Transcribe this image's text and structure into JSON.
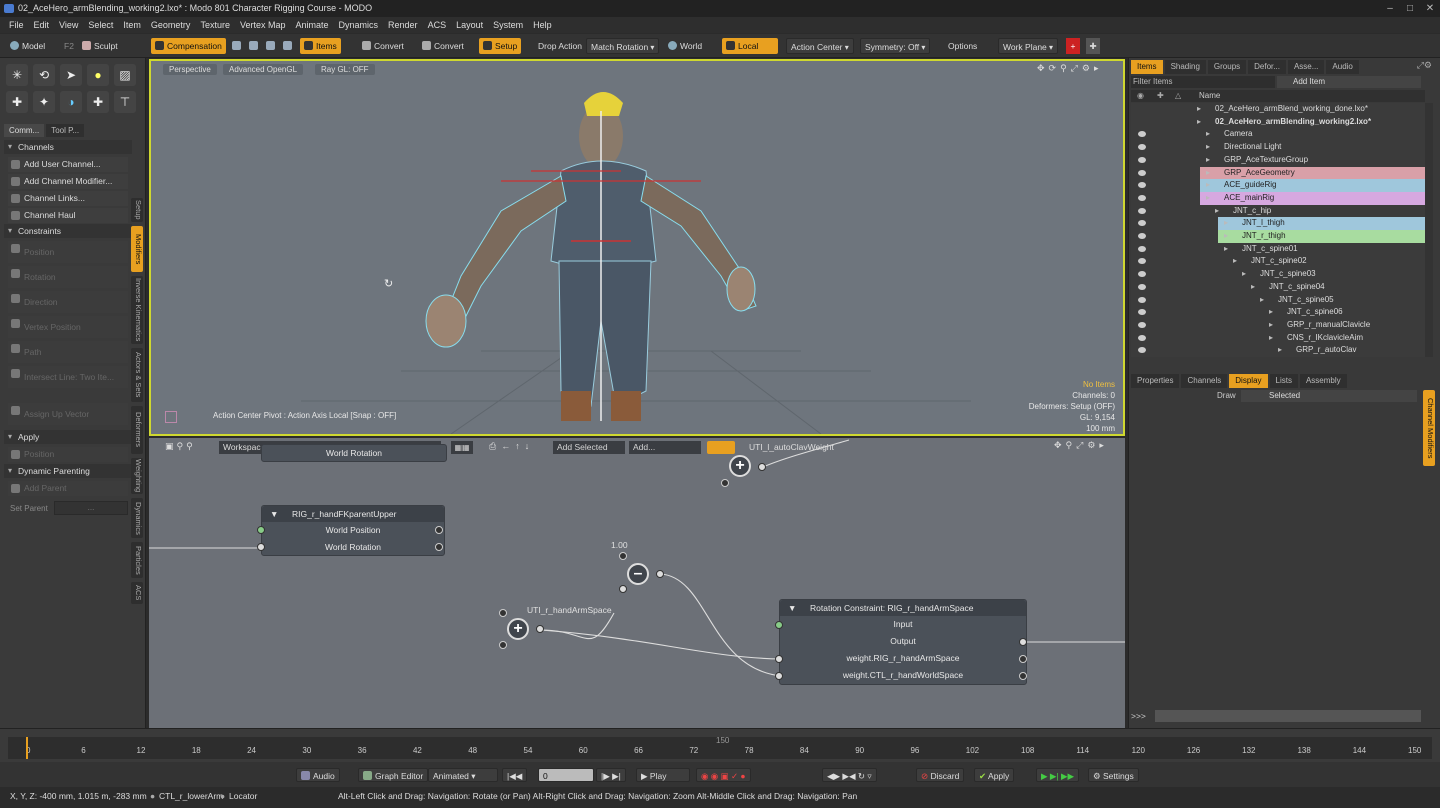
{
  "window": {
    "title": "02_AceHero_armBlending_working2.lxo* : Modo 801 Character Rigging Course - MODO"
  },
  "menu": [
    "File",
    "Edit",
    "View",
    "Select",
    "Item",
    "Geometry",
    "Texture",
    "Vertex Map",
    "Animate",
    "Dynamics",
    "Render",
    "ACS",
    "Layout",
    "System",
    "Help"
  ],
  "toolbar": {
    "model": "Model",
    "f2": "F2",
    "sculpt": "Sculpt",
    "compensation": "Compensation",
    "items": "Items",
    "convert1": "Convert",
    "convert2": "Convert",
    "setup": "Setup",
    "drop_action": "Drop Action",
    "match_rotation": "Match Rotation",
    "world": "World",
    "local": "Local",
    "action_center": "Action Center",
    "symmetry": "Symmetry: Off",
    "options": "Options",
    "work_plane": "Work Plane"
  },
  "left_panel": {
    "tabs": [
      "Comm...",
      "Tool P..."
    ],
    "vertical_tabs": [
      "Setup",
      "Modifiers",
      "Inverse Kinematics",
      "Actors & Sets",
      "Deformers",
      "Weighting",
      "Dynamics",
      "Particles",
      "ACS"
    ],
    "channels_header": "Channels",
    "channel_buttons": [
      "Add User Channel...",
      "Add Channel Modifier...",
      "Channel Links...",
      "Channel Haul"
    ],
    "constraints_header": "Constraints",
    "constraint_buttons": [
      "Position",
      "Rotation",
      "Direction",
      "Vertex Position",
      "Path",
      "Intersect Line: Two Ite..."
    ],
    "assign_up_vector": "Assign Up Vector",
    "apply_header": "Apply",
    "apply_position": "Position",
    "dynamic_parenting_header": "Dynamic Parenting",
    "add_parent": "Add Parent",
    "set_parent": "Set Parent",
    "set_parent_value": "..."
  },
  "viewport": {
    "view_label": "Perspective",
    "shading": "Advanced OpenGL",
    "raygl": "Ray GL: OFF",
    "status_line": "Action Center Pivot : Action Axis Local  [Snap : OFF]",
    "info": {
      "no_items": "No Items",
      "channels": "Channels: 0",
      "deformers": "Deformers: Setup (OFF)",
      "gl": "GL: 9,154",
      "scale": "100 mm"
    }
  },
  "node_editor": {
    "workspace_label": "Workspace: Workspace",
    "add_selected": "Add Selected",
    "add": "Add...",
    "nodes": {
      "world_rotation": "World Rotation",
      "hand_fk_parent": {
        "title": "RIG_r_handFKparentUpper",
        "rows": [
          "World Position",
          "World Rotation"
        ]
      },
      "rotation_constraint": {
        "title": "Rotation Constraint: RIG_r_handArmSpace",
        "rows": [
          "Input",
          "Output",
          "weight.RIG_r_handArmSpace",
          "weight.CTL_r_handWorldSpace"
        ]
      }
    },
    "labels": {
      "uti_l": "UTI_l_autoClavWeight",
      "uti_r": "UTI_r_handArmSpace",
      "value": "1.00"
    }
  },
  "right_panel": {
    "tabs": [
      "Items",
      "Shading",
      "Groups",
      "Defor...",
      "Asse...",
      "Audio"
    ],
    "filter": "Filter Items",
    "add_item": "Add Item",
    "name_header": "Name",
    "items": [
      {
        "label": "02_AceHero_armBlend_working_done.lxo*",
        "indent": 0,
        "bold": false,
        "color": ""
      },
      {
        "label": "02_AceHero_armBlending_working2.lxo*",
        "indent": 0,
        "bold": true,
        "color": ""
      },
      {
        "label": "Camera",
        "indent": 1,
        "bold": false,
        "color": ""
      },
      {
        "label": "Directional Light",
        "indent": 1,
        "bold": false,
        "color": ""
      },
      {
        "label": "GRP_AceTextureGroup",
        "indent": 1,
        "bold": false,
        "color": ""
      },
      {
        "label": "GRP_AceGeometry",
        "indent": 1,
        "bold": false,
        "color": "#d9a0a8"
      },
      {
        "label": "ACE_guideRig",
        "indent": 1,
        "bold": false,
        "color": "#9fc7dc"
      },
      {
        "label": "ACE_mainRig",
        "indent": 1,
        "bold": false,
        "color": "#d6a8e0"
      },
      {
        "label": "JNT_c_hip",
        "indent": 2,
        "bold": false,
        "color": ""
      },
      {
        "label": "JNT_l_thigh",
        "indent": 3,
        "bold": false,
        "color": "#9fc7dc"
      },
      {
        "label": "JNT_r_thigh",
        "indent": 3,
        "bold": false,
        "color": "#a8dca0"
      },
      {
        "label": "JNT_c_spine01",
        "indent": 3,
        "bold": false,
        "color": ""
      },
      {
        "label": "JNT_c_spine02",
        "indent": 4,
        "bold": false,
        "color": ""
      },
      {
        "label": "JNT_c_spine03",
        "indent": 5,
        "bold": false,
        "color": ""
      },
      {
        "label": "JNT_c_spine04",
        "indent": 6,
        "bold": false,
        "color": ""
      },
      {
        "label": "JNT_c_spine05",
        "indent": 7,
        "bold": false,
        "color": ""
      },
      {
        "label": "JNT_c_spine06",
        "indent": 8,
        "bold": false,
        "color": ""
      },
      {
        "label": "GRP_r_manualClavicle",
        "indent": 8,
        "bold": false,
        "color": ""
      },
      {
        "label": "CNS_r_IKclavicleAim",
        "indent": 8,
        "bold": false,
        "color": ""
      },
      {
        "label": "GRP_r_autoClav",
        "indent": 9,
        "bold": false,
        "color": ""
      }
    ],
    "lower_tabs": [
      "Properties",
      "Channels",
      "Display",
      "Lists",
      "Assembly"
    ],
    "draw_label": "Draw",
    "draw_value": "Selected",
    "side_tab": "Channel Modifiers",
    "command_prompt": ">>>"
  },
  "timeline": {
    "ticks": [
      "0",
      "6",
      "12",
      "18",
      "24",
      "30",
      "36",
      "42",
      "48",
      "54",
      "60",
      "66",
      "72",
      "78",
      "84",
      "90",
      "96",
      "102",
      "108",
      "114",
      "120",
      "126",
      "132",
      "138",
      "144",
      "150"
    ],
    "end_marker": "150"
  },
  "transport": {
    "audio": "Audio",
    "graph_editor": "Graph Editor",
    "animated": "Animated",
    "frame": "0",
    "play": "Play",
    "discard": "Discard",
    "apply": "Apply",
    "settings": "Settings"
  },
  "status": {
    "coords": "X, Y, Z:  -400 mm, 1.015 m, -283 mm",
    "selection": "CTL_r_lowerArm",
    "type": "Locator",
    "hints": "Alt-Left Click and Drag: Navigation: Rotate (or Pan)   Alt-Right Click and Drag: Navigation: Zoom   Alt-Middle Click and Drag: Navigation: Pan"
  },
  "colors": {
    "accent": "#e8a020",
    "viewport_border": "#cfd830",
    "viewport_bg": "#6e757d",
    "node_bg": "#6c7077"
  }
}
